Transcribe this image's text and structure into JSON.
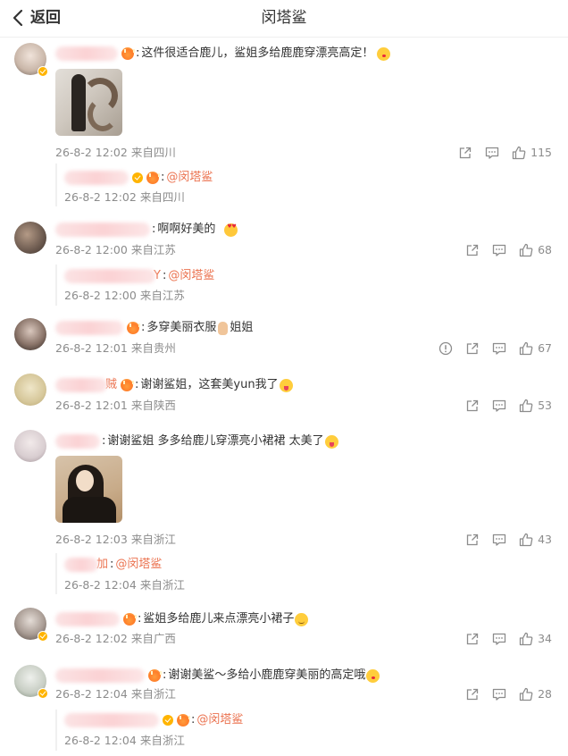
{
  "header": {
    "back_label": "返回",
    "title": "闵塔鲨"
  },
  "comments": [
    {
      "text": "这件很适合鹿儿，鲨姐多给鹿鹿穿漂亮高定！",
      "emoji": "kiss",
      "time": "26-8-2 12:02",
      "location": "来自四川",
      "likes": "115",
      "has_image": true,
      "reply": {
        "target": "@闵塔鲨",
        "time": "26-8-2 12:02",
        "location": "来自四川"
      }
    },
    {
      "text": "啊啊好美的",
      "emoji": "heart-eyes",
      "time": "26-8-2 12:00",
      "location": "来自江苏",
      "likes": "68",
      "reply": {
        "name_tail": "Y",
        "target": "@闵塔鲨",
        "time": "26-8-2 12:00",
        "location": "来自江苏"
      }
    },
    {
      "text_before": "多穿美丽衣服",
      "text_after": "姐姐",
      "time": "26-8-2 12:01",
      "location": "来自贵州",
      "likes": "67"
    },
    {
      "name_tail": "贼",
      "text": "谢谢鲨姐，这套美yun我了",
      "emoji": "tongue",
      "time": "26-8-2 12:01",
      "location": "来自陕西",
      "likes": "53"
    },
    {
      "text": "谢谢鲨姐 多多给鹿儿穿漂亮小裙裙 太美了",
      "emoji": "tongue",
      "time": "26-8-2 12:03",
      "location": "来自浙江",
      "likes": "43",
      "has_image": true,
      "reply": {
        "name_tail": "加",
        "target": "@闵塔鲨",
        "time": "26-8-2 12:04",
        "location": "来自浙江"
      }
    },
    {
      "text": "鲨姐多给鹿儿来点漂亮小裙子",
      "emoji": "smirk",
      "time": "26-8-2 12:02",
      "location": "来自广西",
      "likes": "34"
    },
    {
      "text": "谢谢美鲨～多给小鹿鹿穿美丽的高定哦",
      "emoji": "kiss",
      "time": "26-8-2 12:04",
      "location": "来自浙江",
      "likes": "28",
      "reply": {
        "target": "@闵塔鲨",
        "time": "26-8-2 12:04",
        "location": "来自浙江"
      }
    }
  ],
  "colors": {
    "link": "#eb7350",
    "meta": "#8c8c8c",
    "vip": "#ffb400"
  },
  "icons": [
    "chevron-left-icon",
    "share-icon",
    "comment-icon",
    "like-icon",
    "report-icon",
    "vip-badge-icon",
    "crown-badge-icon"
  ]
}
